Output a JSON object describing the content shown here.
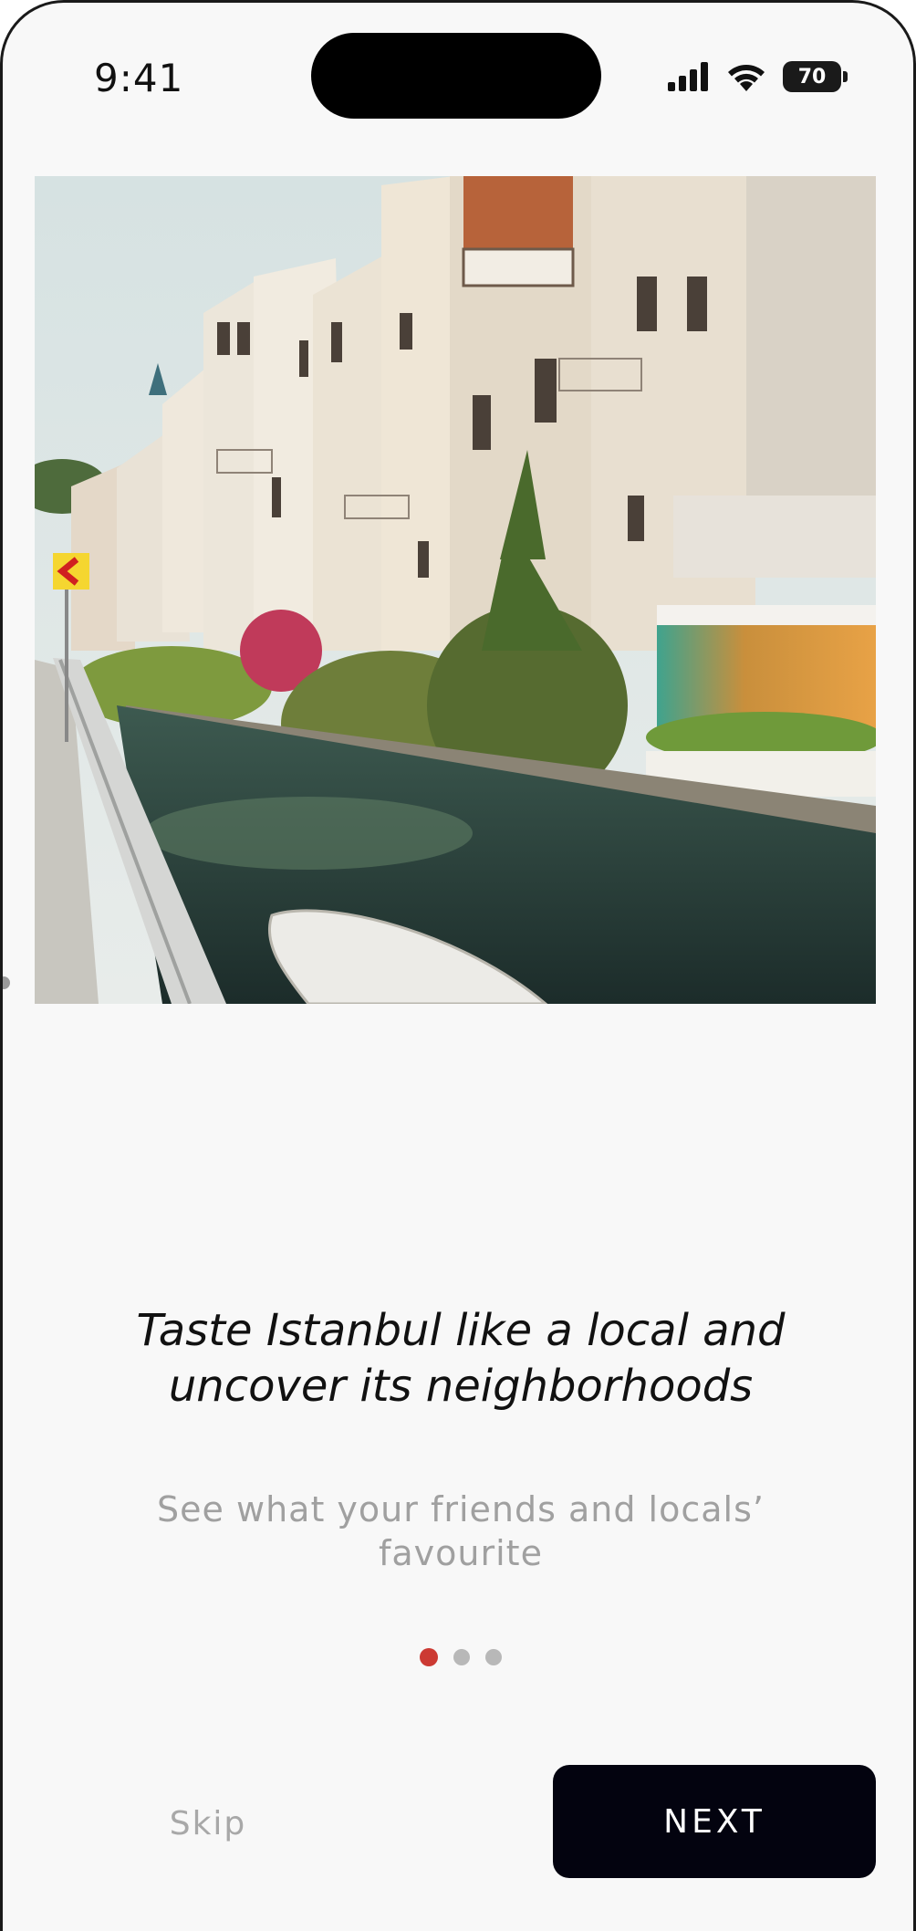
{
  "status_bar": {
    "time": "9:41",
    "battery": "70",
    "icons": [
      "signal-icon",
      "wifi-icon",
      "battery-icon"
    ]
  },
  "hero": {
    "image": "photo of wooden Ottoman houses along a canal in Istanbul with a boat"
  },
  "onboarding": {
    "title_line1": "Taste Istanbul like a local and",
    "title_line2": "uncover its neighborhoods",
    "subtitle_line1": "See what your friends and locals’",
    "subtitle_line2": "favourite",
    "page_count": 3,
    "active_page": 1
  },
  "actions": {
    "skip_label": "Skip",
    "next_label": "NEXT"
  },
  "colors": {
    "background": "#f8f8f8",
    "accent": "#cc3a33",
    "button": "#03030f",
    "muted_text": "#a0a0a0"
  }
}
